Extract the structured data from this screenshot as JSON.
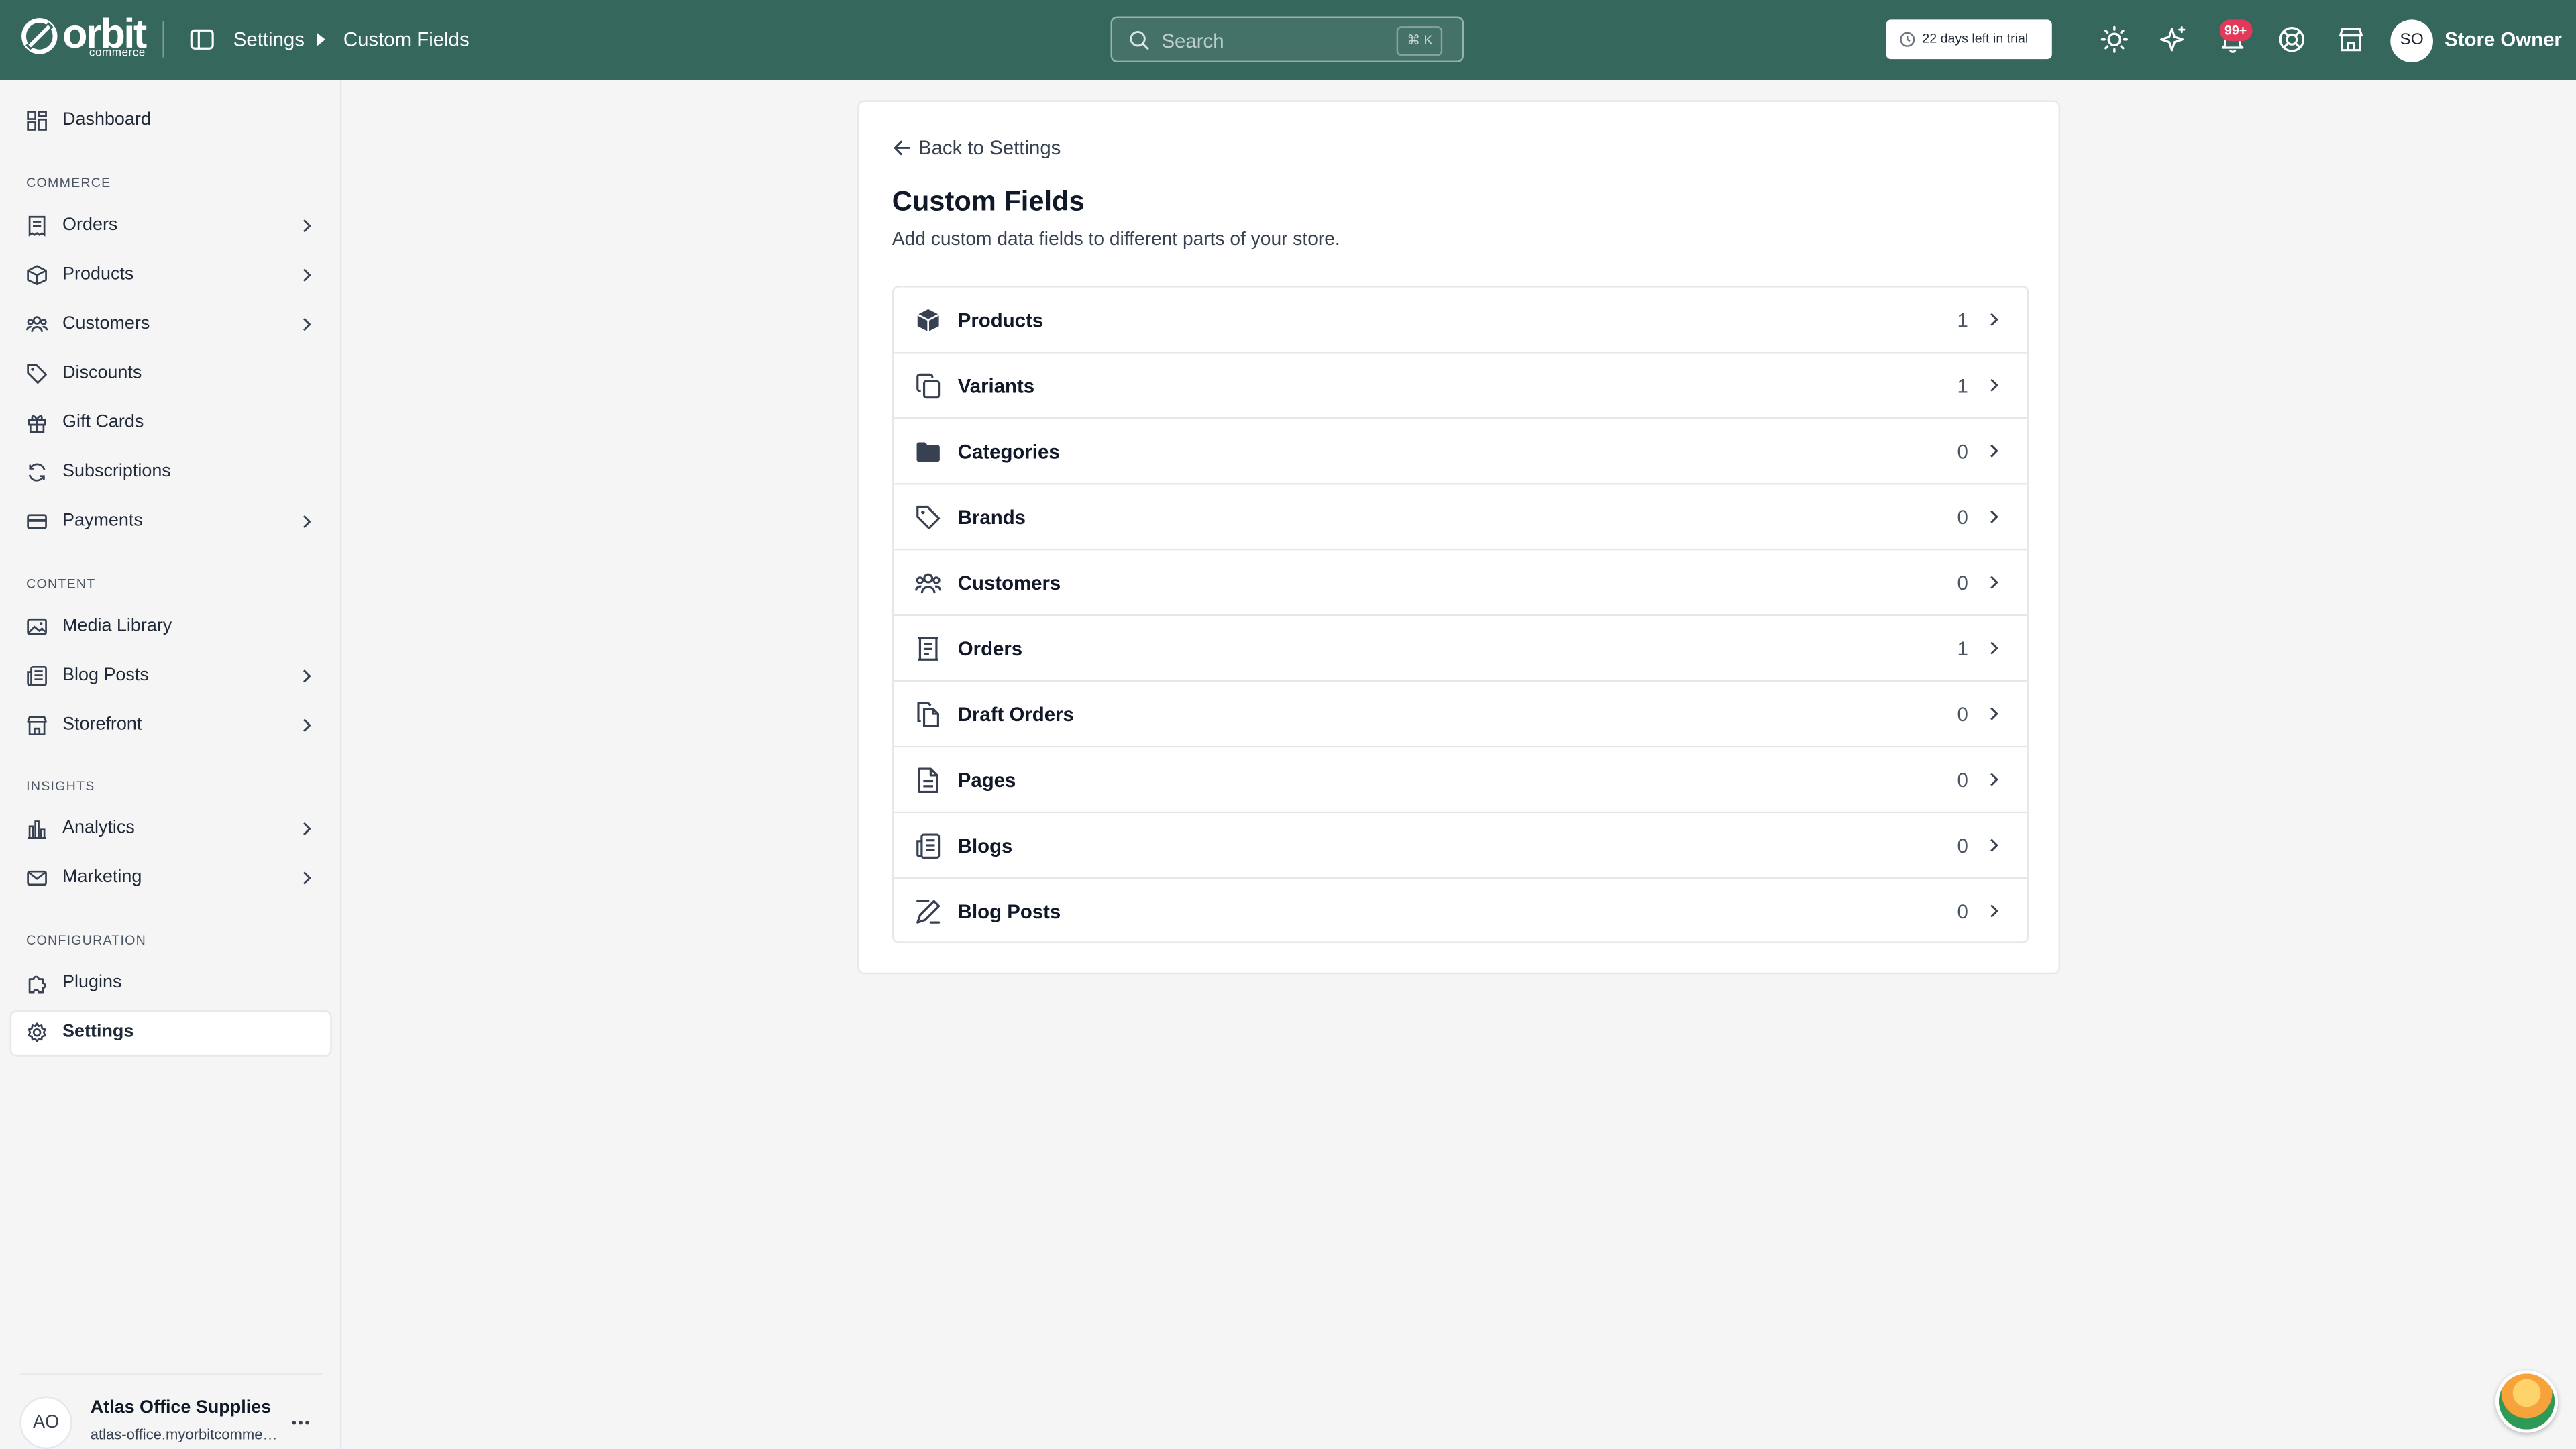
{
  "brand": {
    "word": "orbit",
    "sub": "commerce"
  },
  "breadcrumb": {
    "parent": "Settings",
    "current": "Custom Fields"
  },
  "search": {
    "placeholder": "Search",
    "shortcut": "⌘ K"
  },
  "trial": {
    "label": "22 days left in trial"
  },
  "notifications": {
    "badge": "99+"
  },
  "user": {
    "initials": "SO",
    "name": "Store Owner"
  },
  "sidebar": {
    "dashboard": "Dashboard",
    "sections": {
      "commerce": "COMMERCE",
      "content": "CONTENT",
      "insights": "INSIGHTS",
      "configuration": "CONFIGURATION"
    },
    "items": {
      "orders": "Orders",
      "products": "Products",
      "customers": "Customers",
      "discounts": "Discounts",
      "gift_cards": "Gift Cards",
      "subscriptions": "Subscriptions",
      "payments": "Payments",
      "media_library": "Media Library",
      "blog_posts": "Blog Posts",
      "storefront": "Storefront",
      "analytics": "Analytics",
      "marketing": "Marketing",
      "plugins": "Plugins",
      "settings": "Settings"
    },
    "store": {
      "initials": "AO",
      "name": "Atlas Office Supplies",
      "url": "atlas-office.myorbitcommerce.com"
    }
  },
  "page": {
    "back_label": "Back to Settings",
    "title": "Custom Fields",
    "description": "Add custom data fields to different parts of your store."
  },
  "fields": [
    {
      "label": "Products",
      "count": "1",
      "icon": "cube-icon"
    },
    {
      "label": "Variants",
      "count": "1",
      "icon": "copy-icon"
    },
    {
      "label": "Categories",
      "count": "0",
      "icon": "folder-icon"
    },
    {
      "label": "Brands",
      "count": "0",
      "icon": "tag-icon"
    },
    {
      "label": "Customers",
      "count": "0",
      "icon": "users-icon"
    },
    {
      "label": "Orders",
      "count": "1",
      "icon": "receipt-icon"
    },
    {
      "label": "Draft Orders",
      "count": "0",
      "icon": "files-icon"
    },
    {
      "label": "Pages",
      "count": "0",
      "icon": "file-text-icon"
    },
    {
      "label": "Blogs",
      "count": "0",
      "icon": "newspaper-icon"
    },
    {
      "label": "Blog Posts",
      "count": "0",
      "icon": "pen-line-icon"
    }
  ],
  "colors": {
    "topbar": "#35675d",
    "badge": "#e23a5a",
    "background": "#f5f5f5"
  }
}
